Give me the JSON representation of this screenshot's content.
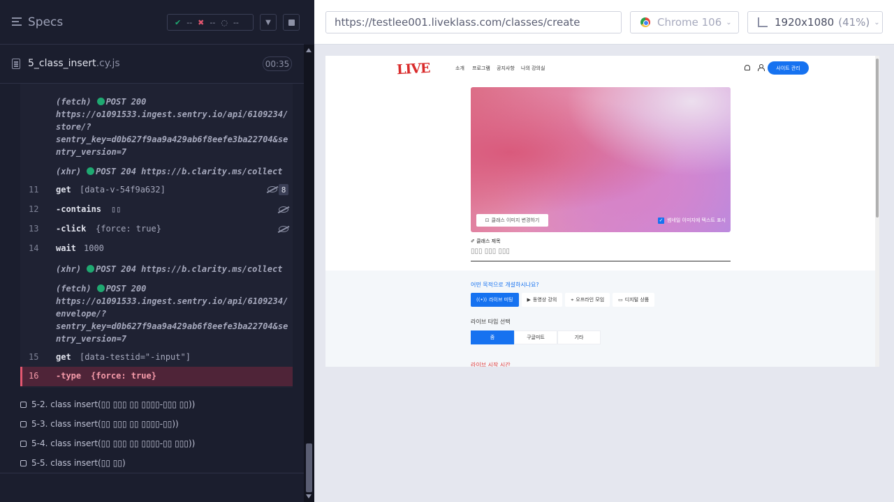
{
  "reporter": {
    "specs_title": "Specs",
    "stats": {
      "passed": "--",
      "failed": "--",
      "pending": "--"
    },
    "file": {
      "name": "5_class_insert",
      "ext": ".cy.js",
      "duration": "00:35"
    },
    "net": [
      {
        "kind": "(fetch)",
        "method": "POST 200",
        "lines": [
          "https://o1091533.ingest.sentry.io/api/6109234/",
          "store/?",
          "sentry_key=d0b627f9aa9a429ab6f8eefe3ba22704&se",
          "ntry_version=7"
        ]
      },
      {
        "kind": "(xhr)",
        "method": "POST 204",
        "url": "https://b.clarity.ms/collect"
      },
      {
        "kind": "(xhr)",
        "method": "POST 204",
        "url": "https://b.clarity.ms/collect"
      },
      {
        "kind": "(fetch)",
        "method": "POST 200",
        "lines": [
          "https://o1091533.ingest.sentry.io/api/6109234/",
          "envelope/?",
          "sentry_key=d0b627f9aa9a429ab6f8eefe3ba22704&se",
          "ntry_version=7"
        ]
      }
    ],
    "commands": [
      {
        "num": "11",
        "name": "get",
        "msg": "[data-v-54f9a632]",
        "badge": "8"
      },
      {
        "num": "12",
        "name": "-contains",
        "msg": "▯▯"
      },
      {
        "num": "13",
        "name": "-click",
        "msg": "{force: true}"
      },
      {
        "num": "14",
        "name": "wait",
        "msg": "1000"
      },
      {
        "num": "15",
        "name": "get",
        "msg": "[data-testid=\"-input\"]"
      },
      {
        "num": "16",
        "name": "-type",
        "msg": "{force: true}"
      }
    ],
    "pending_tests": [
      "5-2. class insert(▯▯ ▯▯▯ ▯▯ ▯▯▯▯-▯▯▯ ▯▯))",
      "5-3. class insert(▯▯ ▯▯▯ ▯▯ ▯▯▯▯-▯▯))",
      "5-4. class insert(▯▯ ▯▯▯ ▯▯ ▯▯▯▯-▯▯ ▯▯▯))",
      "5-5. class insert(▯▯ ▯▯)"
    ]
  },
  "browser": {
    "url": "https://testlee001.liveklass.com/classes/create",
    "name": "Chrome 106",
    "viewport": "1920x1080",
    "scale": "(41%)"
  },
  "app": {
    "logo": "LIVE",
    "nav": [
      "소개",
      "프로그램",
      "공지사항",
      "나의 강의실"
    ],
    "admin_button": "사이트 관리",
    "image_change": "클래스 이미지 변경하기",
    "text_show": "썸네일 이미지에 텍스트 표시",
    "title_label": "✐ 클래스 제목",
    "title_placeholder": "▯▯▯ ▯▯▯ ▯▯▯",
    "purpose_question": "어떤 목적으로 개설하시나요?",
    "purposes": [
      "라이브 미팅",
      "동영상 강의",
      "오프라인 모임",
      "디지털 상품"
    ],
    "live_type_label": "라이브 타입 선택",
    "live_types": [
      "줌",
      "구글미트",
      "기타"
    ],
    "live_start_label": "라이브 시작 시간"
  }
}
